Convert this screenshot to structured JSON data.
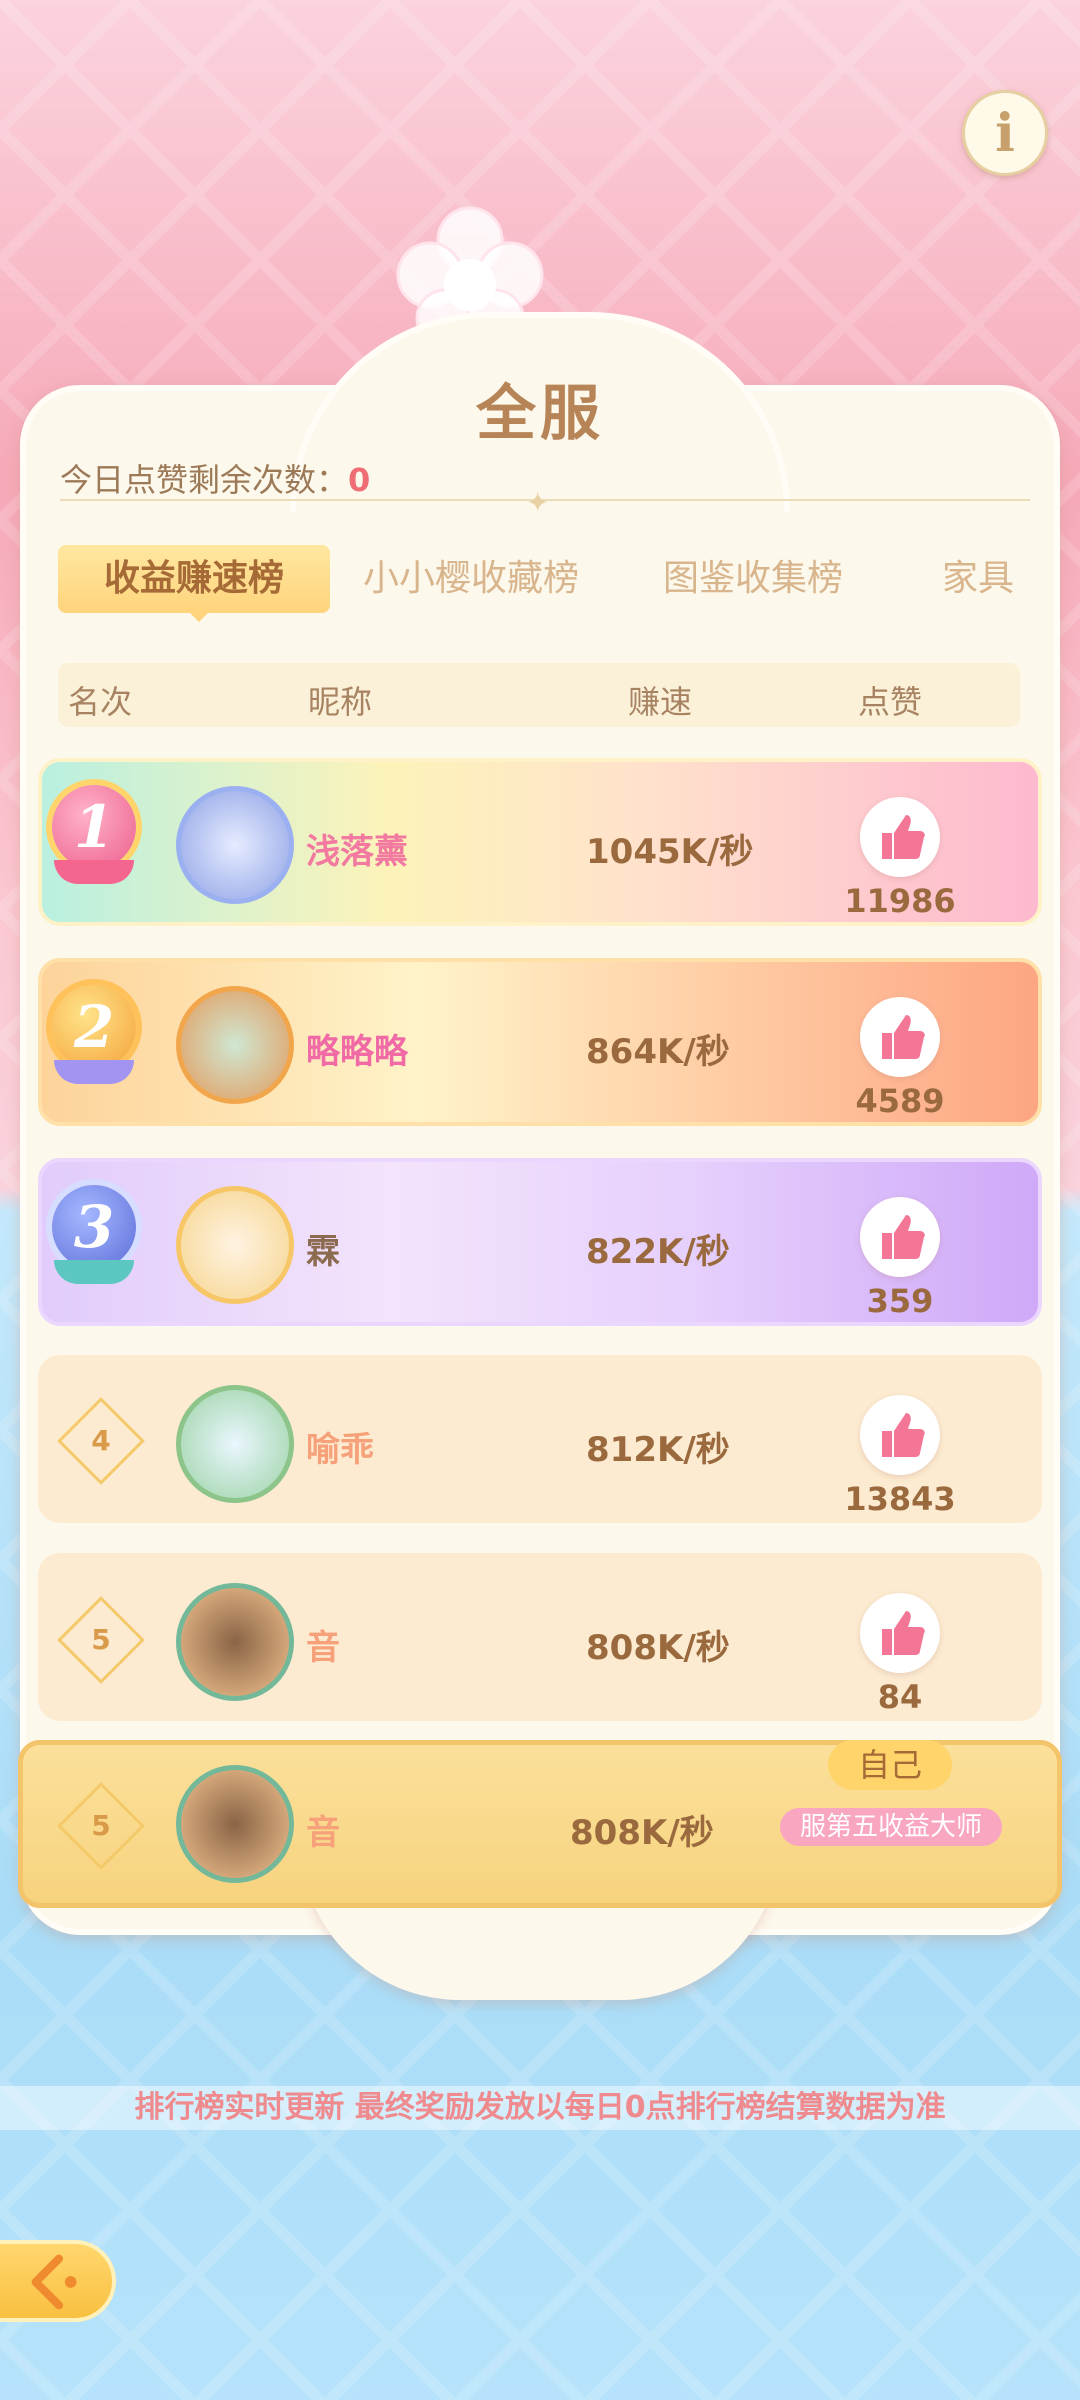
{
  "header": {
    "title": "全服",
    "likes_remaining_label": "今日点赞剩余次数：",
    "likes_remaining_value": "0",
    "info_icon": "info-icon"
  },
  "tabs": [
    {
      "label": "收益赚速榜",
      "active": true
    },
    {
      "label": "小小樱收藏榜",
      "active": false
    },
    {
      "label": "图鉴收集榜",
      "active": false
    },
    {
      "label": "家具",
      "active": false
    }
  ],
  "columns": {
    "rank": "名次",
    "nickname": "昵称",
    "speed": "赚速",
    "likes": "点赞"
  },
  "rows": [
    {
      "rank": "1",
      "name": "浅落薰",
      "speed": "1045K/秒",
      "likes": "11986",
      "name_color": "#f27aa0"
    },
    {
      "rank": "2",
      "name": "略略略",
      "speed": "864K/秒",
      "likes": "4589",
      "name_color": "#f06aa6"
    },
    {
      "rank": "3",
      "name": "霖",
      "speed": "822K/秒",
      "likes": "359",
      "name_color": "#8b6a50"
    },
    {
      "rank": "4",
      "name": "喻乖",
      "speed": "812K/秒",
      "likes": "13843",
      "name_color": "#f6a17a"
    },
    {
      "rank": "5",
      "name": "音",
      "speed": "808K/秒",
      "likes": "84",
      "name_color": "#f6a17a"
    }
  ],
  "self": {
    "rank": "5",
    "name": "音",
    "speed": "808K/秒",
    "tag": "自己",
    "title_badge": "服第五收益大师"
  },
  "notice": "排行榜实时更新 最终奖励发放以每日0点排行榜结算数据为准",
  "colors": {
    "accent": "#ef6e76",
    "brown": "#9a6a3e",
    "gold": "#ffd46b"
  }
}
